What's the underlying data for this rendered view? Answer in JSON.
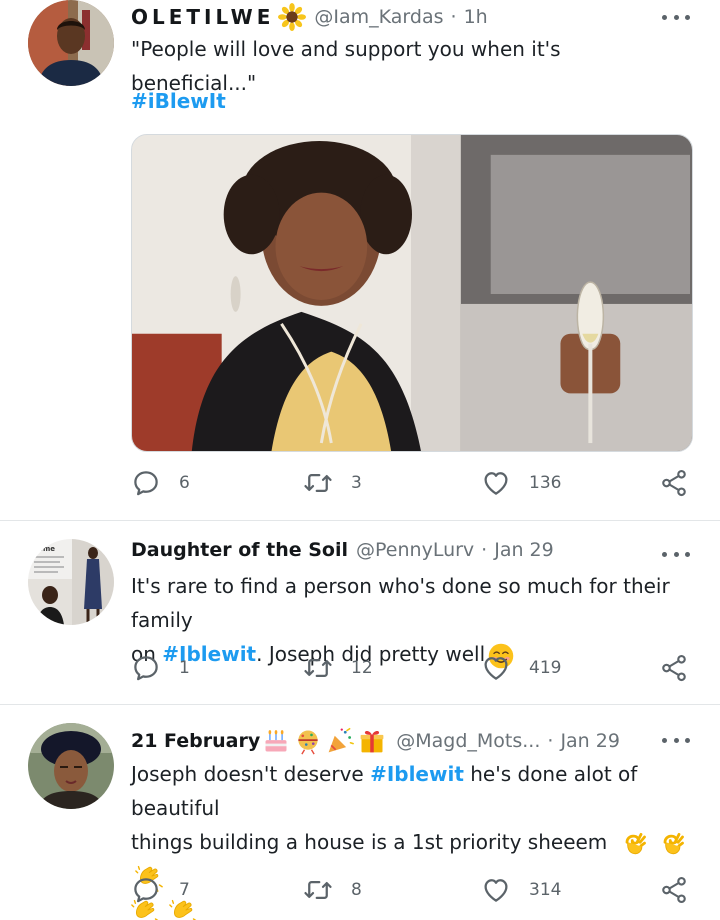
{
  "tweets": [
    {
      "name": "OLETILWE",
      "handle": "@Iam_Kardas",
      "dot": "·",
      "time": "1h",
      "name_emojis": [
        "sunflower-emoji"
      ],
      "text_1": "\"People will love and support you when it's beneficial...\"",
      "hashtag": "#iBlewIt",
      "replies": "6",
      "retweets": "3",
      "likes": "136"
    },
    {
      "name": "Daughter of the Soil",
      "handle": "@PennyLurv",
      "dot": "·",
      "time": "Jan 29",
      "text_1": "It's rare to find a person who's done so much for their family",
      "text_2_pre": "on ",
      "hashtag": "#Iblewit",
      "text_2_post": ". Joseph did pretty well",
      "text_emojis": [
        "smiling-face-emoji"
      ],
      "replies": "1",
      "retweets": "12",
      "likes": "419"
    },
    {
      "name": "21 February",
      "handle": "@Magd_Mots...",
      "dot": "·",
      "time": "Jan 29",
      "name_emojis": [
        "birthday-cake-emoji",
        "confetti-ball-emoji",
        "party-popper-emoji",
        "wrapped-gift-emoji"
      ],
      "text_1_pre": "Joseph doesn't deserve ",
      "hashtag": "#Iblewit",
      "text_1_post": " he's done alot of beautiful",
      "text_2": "things building a house is a 1st priority sheeem",
      "text_emojis": [
        "ok-hand-emoji",
        "ok-hand-emoji",
        "clapping-hands-emoji",
        "clapping-hands-emoji",
        "clapping-hands-emoji"
      ],
      "replies": "7",
      "retweets": "8",
      "likes": "314"
    }
  ],
  "colors": {
    "link": "#1d9bf0",
    "icon": "#5b6369",
    "divider": "#e3e6e8"
  },
  "icons": [
    "reply-icon",
    "retweet-icon",
    "like-icon",
    "share-icon",
    "more-options-icon"
  ]
}
